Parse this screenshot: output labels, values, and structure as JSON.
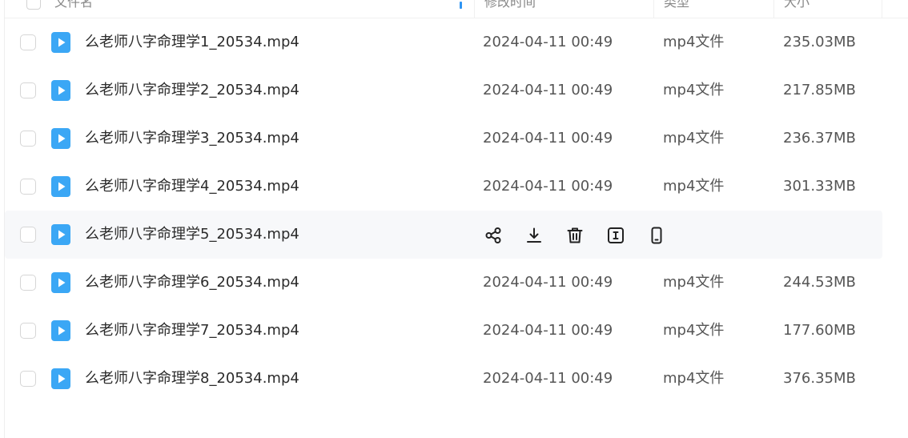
{
  "header": {
    "name_label": "文件名",
    "time_label": "修改时间",
    "type_label": "类型",
    "size_label": "大小"
  },
  "colors": {
    "file_icon": "#3ba7f5",
    "hover_row": "#f7f8fa",
    "sort_accent": "#2f95f3"
  },
  "rows": [
    {
      "name": "么老师八字命理学1_20534.mp4",
      "time": "2024-04-11 00:49",
      "type": "mp4文件",
      "size": "235.03MB"
    },
    {
      "name": "么老师八字命理学2_20534.mp4",
      "time": "2024-04-11 00:49",
      "type": "mp4文件",
      "size": "217.85MB"
    },
    {
      "name": "么老师八字命理学3_20534.mp4",
      "time": "2024-04-11 00:49",
      "type": "mp4文件",
      "size": "236.37MB"
    },
    {
      "name": "么老师八字命理学4_20534.mp4",
      "time": "2024-04-11 00:49",
      "type": "mp4文件",
      "size": "301.33MB"
    },
    {
      "name": "么老师八字命理学5_20534.mp4",
      "hovered": true,
      "actions": [
        "share-icon",
        "download-icon",
        "delete-icon",
        "rename-icon",
        "mobile-icon"
      ]
    },
    {
      "name": "么老师八字命理学6_20534.mp4",
      "time": "2024-04-11 00:49",
      "type": "mp4文件",
      "size": "244.53MB"
    },
    {
      "name": "么老师八字命理学7_20534.mp4",
      "time": "2024-04-11 00:49",
      "type": "mp4文件",
      "size": "177.60MB"
    },
    {
      "name": "么老师八字命理学8_20534.mp4",
      "time": "2024-04-11 00:49",
      "type": "mp4文件",
      "size": "376.35MB"
    }
  ]
}
